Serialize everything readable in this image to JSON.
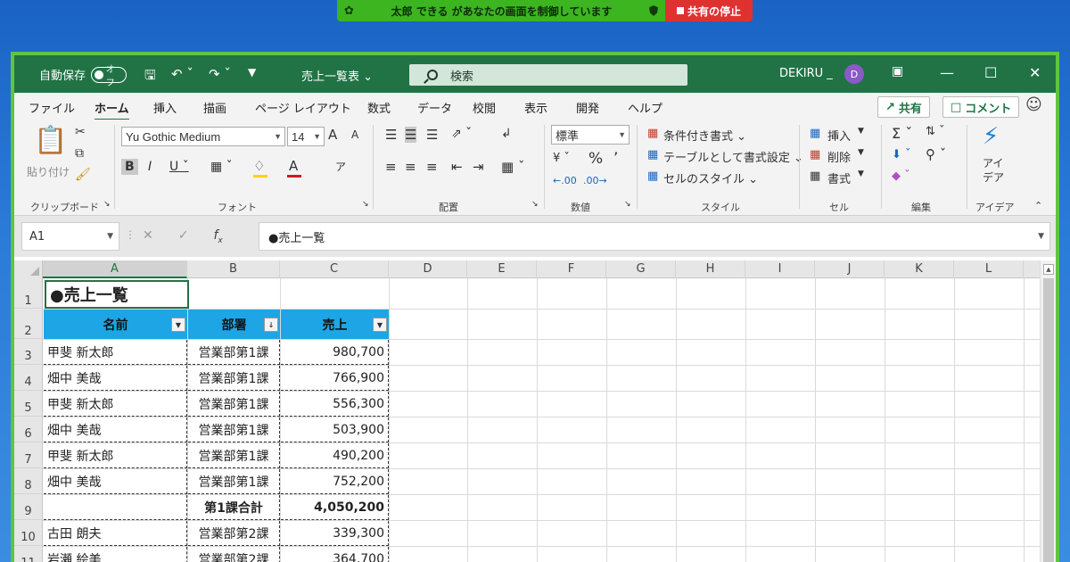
{
  "share_bar": {
    "message": "太郎 できる があなたの画面を制御しています",
    "stop_label": "共有の停止"
  },
  "titlebar": {
    "autosave_label": "自動保存",
    "autosave_state": "オフ",
    "file_name": "売上一覧表 ⌄",
    "search_placeholder": "検索",
    "user_name": "DEKIRU _",
    "avatar_initial": "D"
  },
  "menu": {
    "tabs": [
      "ファイル",
      "ホーム",
      "挿入",
      "描画",
      "ページ レイアウト",
      "数式",
      "データ",
      "校閲",
      "表示",
      "開発",
      "ヘルプ"
    ],
    "active_tab": "ホーム",
    "share_label": "共有",
    "comment_label": "コメント"
  },
  "ribbon": {
    "clipboard": {
      "paste_label": "貼り付け",
      "group_label": "クリップボード"
    },
    "font": {
      "font_name": "Yu Gothic Medium",
      "font_size": "14",
      "group_label": "フォント",
      "underline_color": "#ffd200",
      "font_color": "#d0181f",
      "grow": "A",
      "shrink": "A"
    },
    "alignment": {
      "group_label": "配置"
    },
    "number": {
      "format": "標準",
      "group_label": "数値"
    },
    "styles": {
      "conditional": "条件付き書式 ⌄",
      "table": "テーブルとして書式設定 ⌄",
      "cell_styles": "セルのスタイル ⌄",
      "group_label": "スタイル"
    },
    "cells": {
      "insert": "挿入",
      "delete": "削除",
      "format": "書式",
      "group_label": "セル"
    },
    "editing": {
      "group_label": "編集"
    },
    "ideas": {
      "label_line1": "アイ",
      "label_line2": "デア",
      "group_label": "アイデア"
    }
  },
  "formula_bar": {
    "name_box": "A1",
    "formula": "●売上一覧"
  },
  "sheet": {
    "columns": [
      "A",
      "B",
      "C",
      "D",
      "E",
      "F",
      "G",
      "H",
      "I",
      "J",
      "K",
      "L"
    ],
    "rows": [
      "1",
      "2",
      "3",
      "4",
      "5",
      "6",
      "7",
      "8",
      "9",
      "10",
      "11"
    ],
    "title": "●売上一覧",
    "headers": [
      "名前",
      "部署",
      "売上"
    ],
    "data": [
      [
        "甲斐 新太郎",
        "営業部第1課",
        "980,700"
      ],
      [
        "畑中 美哉",
        "営業部第1課",
        "766,900"
      ],
      [
        "甲斐 新太郎",
        "営業部第1課",
        "556,300"
      ],
      [
        "畑中 美哉",
        "営業部第1課",
        "503,900"
      ],
      [
        "甲斐 新太郎",
        "営業部第1課",
        "490,200"
      ],
      [
        "畑中 美哉",
        "営業部第1課",
        "752,200"
      ],
      [
        "",
        "第1課合計",
        "4,050,200"
      ],
      [
        "古田 朗夫",
        "営業部第2課",
        "339,300"
      ],
      [
        "岩瀬 絵美",
        "営業部第2課",
        "364,700"
      ]
    ],
    "header_color": "#1ea5e6"
  }
}
